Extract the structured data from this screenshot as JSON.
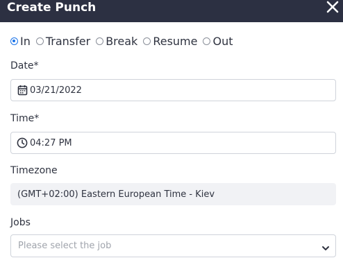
{
  "dialog": {
    "title": "Create Punch"
  },
  "punch_type": {
    "options": [
      "In",
      "Transfer",
      "Break",
      "Resume",
      "Out"
    ],
    "selected": "In"
  },
  "date": {
    "label": "Date*",
    "value": "03/21/2022",
    "icon": "calendar-icon"
  },
  "time": {
    "label": "Time*",
    "value": "04:27 PM",
    "icon": "clock-icon"
  },
  "timezone": {
    "label": "Timezone",
    "value": "(GMT+02:00) Eastern European Time - Kiev"
  },
  "jobs": {
    "label": "Jobs",
    "placeholder": "Please select the job",
    "icon": "chevron-down-icon"
  },
  "colors": {
    "header_bg": "#2c3042",
    "accent": "#1a73e8",
    "readonly_bg": "#f1f2f5"
  }
}
